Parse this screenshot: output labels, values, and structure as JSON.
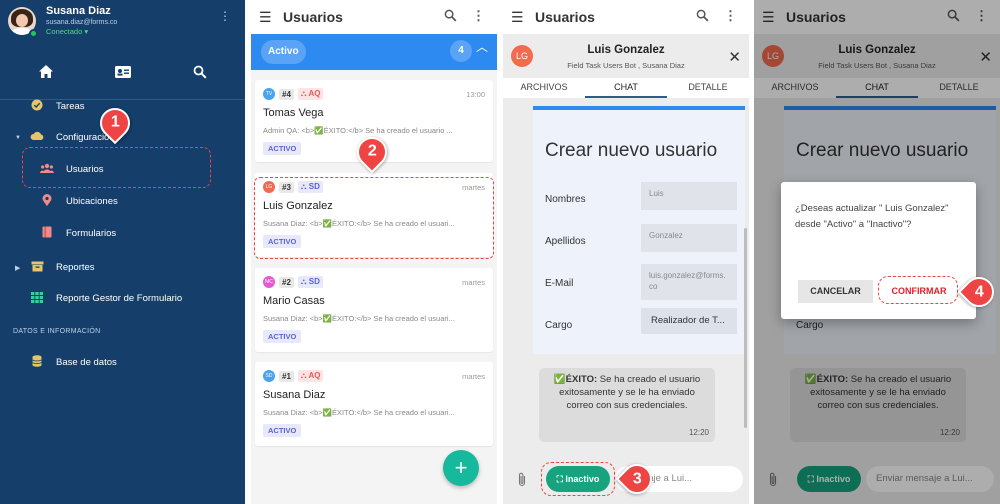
{
  "sidebar": {
    "user_name": "Susana Diaz",
    "user_email": "susana.diaz@forms.co",
    "user_status": "Conectado",
    "items": [
      {
        "label": "Tareas",
        "icon": "check-circle-icon"
      },
      {
        "label": "Configuración",
        "icon": "cloud-icon"
      },
      {
        "label": "Usuarios",
        "icon": "users-icon"
      },
      {
        "label": "Ubicaciones",
        "icon": "map-pin-icon"
      },
      {
        "label": "Formularios",
        "icon": "book-icon"
      },
      {
        "label": "Reportes",
        "icon": "archive-icon"
      },
      {
        "label": "Reporte Gestor de Formulario",
        "icon": "grid-icon"
      }
    ],
    "section_label": "DATOS E INFORMACIÓN",
    "db_item": "Base de datos",
    "marker": "1"
  },
  "list": {
    "title": "Usuarios",
    "active_label": "Activo",
    "active_count": "4",
    "marker": "2",
    "cards": [
      {
        "initials": "TV",
        "avatar_color": "#4aa3f0",
        "num": "#4",
        "team": "AQ",
        "time": "13:00",
        "name": "Tomas Vega",
        "preview": "Admin QA: <b>✅ÉXITO:</b> Se ha creado el usuario ...",
        "state": "ACTIVO"
      },
      {
        "initials": "LG",
        "avatar_color": "#f26a4f",
        "num": "#3",
        "team": "SD",
        "time": "martes",
        "name": "Luis Gonzalez",
        "preview": "Susana Diaz: <b>✅ÉXITO:</b> Se ha creado el usuari...",
        "state": "ACTIVO"
      },
      {
        "initials": "MC",
        "avatar_color": "#e45ad0",
        "num": "#2",
        "team": "SD",
        "time": "martes",
        "name": "Mario Casas",
        "preview": "Susana Diaz: <b>✅ÉXITO:</b> Se ha creado el usuari...",
        "state": "ACTIVO"
      },
      {
        "initials": "SD",
        "avatar_color": "#4aa3f0",
        "num": "#1",
        "team": "AQ",
        "time": "martes",
        "name": "Susana Diaz",
        "preview": "Susana Diaz: <b>✅ÉXITO:</b> Se ha creado el usuari...",
        "state": "ACTIVO"
      }
    ]
  },
  "chat": {
    "title": "Usuarios",
    "avatar": "LG",
    "contact_name": "Luis Gonzalez",
    "contact_sub": "Field Task Users Bot , Susana Diaz",
    "tabs": [
      "ARCHIVOS",
      "CHAT",
      "DETALLE"
    ],
    "form_title": "Crear nuevo usuario",
    "fields": [
      {
        "label": "Nombres",
        "value": "Luis"
      },
      {
        "label": "Apellidos",
        "value": "Gonzalez"
      },
      {
        "label": "E-Mail",
        "value": "luis.gonzalez@forms.co"
      },
      {
        "label": "Cargo",
        "value": "Realizador de T..."
      }
    ],
    "bubble_bold": "✅ÉXITO:",
    "bubble_text": " Se ha creado el usuario exitosamente y se le ha enviado correo con sus credenciales.",
    "bubble_time": "12:20",
    "status_button": "Inactivo",
    "message_placeholder_3": "mensaje a Lui...",
    "message_placeholder_4": "Enviar mensaje a Lui...",
    "marker": "3"
  },
  "dialog": {
    "text": "¿Deseas actualizar \" Luis Gonzalez\" desde \"Activo\" a \"Inactivo\"?",
    "cancel": "CANCELAR",
    "confirm": "CONFIRMAR",
    "marker": "4"
  },
  "colors": {
    "sidebar_bg": "#153e6a",
    "accent_blue": "#2d8af0",
    "success_green": "#16a37e",
    "highlight_red": "#ef4444"
  }
}
